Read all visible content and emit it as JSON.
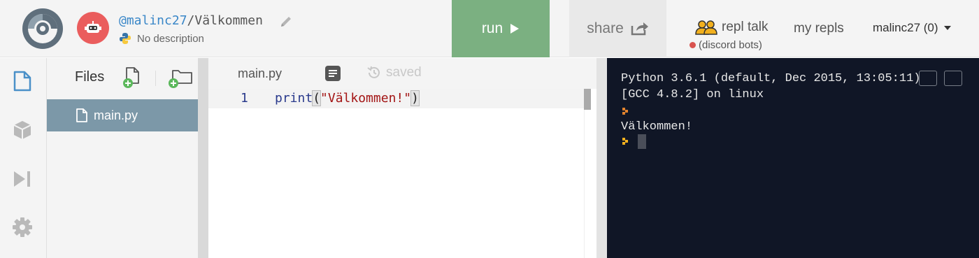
{
  "header": {
    "repl_owner": "@malinc27",
    "repl_separator": "/",
    "repl_name": "Välkommen",
    "description": "No description",
    "run_label": "run",
    "share_label": "share",
    "repl_talk_label": "repl talk",
    "discord_label": "(discord bots)",
    "my_repls_label": "my repls",
    "user_label": "malinc27 (0)"
  },
  "files": {
    "title": "Files",
    "items": [
      {
        "name": "main.py"
      }
    ]
  },
  "editor": {
    "tab_label": "main.py",
    "saved_label": "saved",
    "lines": [
      {
        "number": "1",
        "fn": "print",
        "open": "(",
        "string": "\"Välkommen!\"",
        "close": ")"
      }
    ]
  },
  "console": {
    "lines": [
      "Python 3.6.1 (default, Dec 2015, 13:05:11)",
      "[GCC 4.8.2] on linux",
      "Välkommen!"
    ]
  },
  "colors": {
    "run_green": "#7bb081",
    "console_bg": "#101626",
    "file_selected": "#7c98a8",
    "avatar_red": "#ea5d5d",
    "prompt_orange": "#e0822e"
  },
  "icons": {
    "logo": "repl-logo-icon",
    "edit": "pencil-icon",
    "lang": "python-icon",
    "run": "play-icon",
    "share": "share-icon",
    "talk": "people-icon"
  }
}
